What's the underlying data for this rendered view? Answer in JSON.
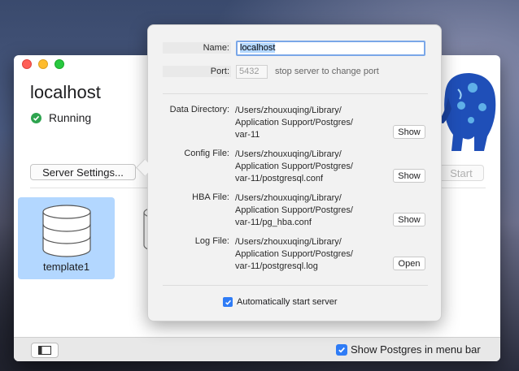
{
  "window": {
    "title": "localhost",
    "status": "Running",
    "settings_button": "Server Settings...",
    "start_button": "Start"
  },
  "databases": [
    {
      "name": "template1"
    }
  ],
  "bottom_bar": {
    "show_menu_bar_label": "Show Postgres in menu bar",
    "show_menu_bar_checked": true
  },
  "settings": {
    "name_label": "Name:",
    "name_value": "localhost",
    "port_label": "Port:",
    "port_value": "5432",
    "port_hint": "stop server to change port",
    "data_dir_label": "Data Directory:",
    "data_dir_lines": [
      "/Users/zhouxuqing/Library/",
      "Application Support/Postgres/",
      "var-11"
    ],
    "data_dir_button": "Show",
    "config_label": "Config File:",
    "config_lines": [
      "/Users/zhouxuqing/Library/",
      "Application Support/Postgres/",
      "var-11/postgresql.conf"
    ],
    "config_button": "Show",
    "hba_label": "HBA File:",
    "hba_lines": [
      "/Users/zhouxuqing/Library/",
      "Application Support/Postgres/",
      "var-11/pg_hba.conf"
    ],
    "hba_button": "Show",
    "log_label": "Log File:",
    "log_lines": [
      "/Users/zhouxuqing/Library/",
      "Application Support/Postgres/",
      "var-11/postgresql.log"
    ],
    "log_button": "Open",
    "auto_start_label": "Automatically start server",
    "auto_start_checked": true
  },
  "icons": [
    "close-icon",
    "minimize-icon",
    "zoom-icon",
    "check-circle-icon",
    "database-icon",
    "sidebar-icon",
    "checkbox-icon",
    "elephant-logo"
  ],
  "colors": {
    "accent": "#2f7cf6",
    "selection": "#b3d7ff",
    "running": "#2ea44f"
  }
}
